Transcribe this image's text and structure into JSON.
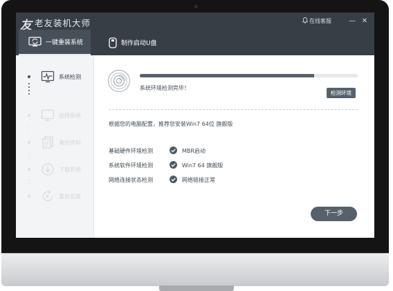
{
  "app": {
    "logo_char": "友",
    "title": "老友装机大师",
    "service_label": "在线客服",
    "minimize_glyph": "—",
    "close_glyph": "✕"
  },
  "tabs": [
    {
      "label": "一键重装系统",
      "icon": "monitor-refresh-icon",
      "active": true
    },
    {
      "label": "制作启动U盘",
      "icon": "usb-drive-icon",
      "active": false
    }
  ],
  "sidebar": {
    "steps": [
      {
        "label": "系统检测",
        "icon": "pulse-monitor-icon",
        "active": true
      },
      {
        "label": "选择系统",
        "icon": "monitor-icon",
        "active": false
      },
      {
        "label": "备份资料",
        "icon": "documents-icon",
        "active": false
      },
      {
        "label": "下载系统",
        "icon": "download-circle-icon",
        "active": false
      },
      {
        "label": "重启安装",
        "icon": "restart-icon",
        "active": false
      }
    ]
  },
  "main": {
    "progress_fraction": 0.8,
    "status_message": "系统环境检测完毕！",
    "check_button": "检测环境",
    "recommendation": "根据您的电脑配置，推荐您安装Win7 64位 旗舰版",
    "checks": [
      {
        "label": "基础硬件环境检测",
        "value": "MBR启动"
      },
      {
        "label": "系统软件环境检测",
        "value": "Win7 64 旗舰版"
      },
      {
        "label": "网络连接状态检测",
        "value": "网络链接正常"
      }
    ],
    "next_button": "下一步"
  },
  "colors": {
    "titlebar": "#373e45",
    "accent": "#56616b",
    "sidebar_bg": "#f3f4f5",
    "check_ok": "#4d5a66"
  }
}
